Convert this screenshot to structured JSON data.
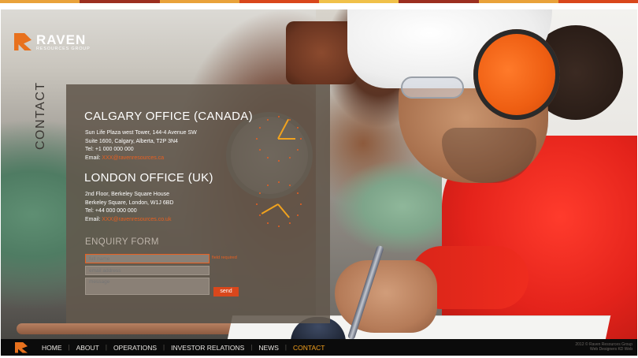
{
  "brand": {
    "name": "RAVEN",
    "subtitle": "RESOURCES GROUP"
  },
  "colors": {
    "accent": "#e96020",
    "nav_active": "#f5a11d",
    "stripe": [
      "#e9a23a",
      "#9c2f20",
      "#e9a23a",
      "#d9471c",
      "#f0c14a",
      "#9c2f20",
      "#e9a23a",
      "#d9471c"
    ]
  },
  "contact_heading": "CONTACT",
  "offices": [
    {
      "title": "CALGARY OFFICE (CANADA)",
      "address1": "Sun Life Plaza west Tower, 144-4 Avenue SW",
      "address2": "Suite 1600, Calgary, Alberta, T2P 3N4",
      "tel": "Tel:  +1 000 000 000",
      "email_label": "Email:",
      "email": "XXX@ravenresources.ca",
      "clock_icon": "clock-icon"
    },
    {
      "title": "LONDON OFFICE (UK)",
      "address1": "2nd Floor, Berkeley Square House",
      "address2": "Berkeley Square, London, W1J 6BD",
      "tel": "Tel:  +44 000 000 000",
      "email_label": "Email:",
      "email": "XXX@ravenresources.co.uk",
      "clock_icon": "clock-icon"
    }
  ],
  "enquiry": {
    "title": "ENQUIRY FORM",
    "name_placeholder": "full name",
    "email_placeholder": "email address",
    "message_placeholder": "message",
    "required_note": "field required",
    "send_label": "send"
  },
  "nav": {
    "items": [
      {
        "label": "HOME",
        "active": false
      },
      {
        "label": "ABOUT",
        "active": false
      },
      {
        "label": "OPERATIONS",
        "active": false
      },
      {
        "label": "INVESTOR RELATIONS",
        "active": false
      },
      {
        "label": "NEWS",
        "active": false
      },
      {
        "label": "CONTACT",
        "active": true
      }
    ],
    "credit_line1": "2012 © Raven Resources Group",
    "credit_line2": "Web Designers KD Web"
  }
}
